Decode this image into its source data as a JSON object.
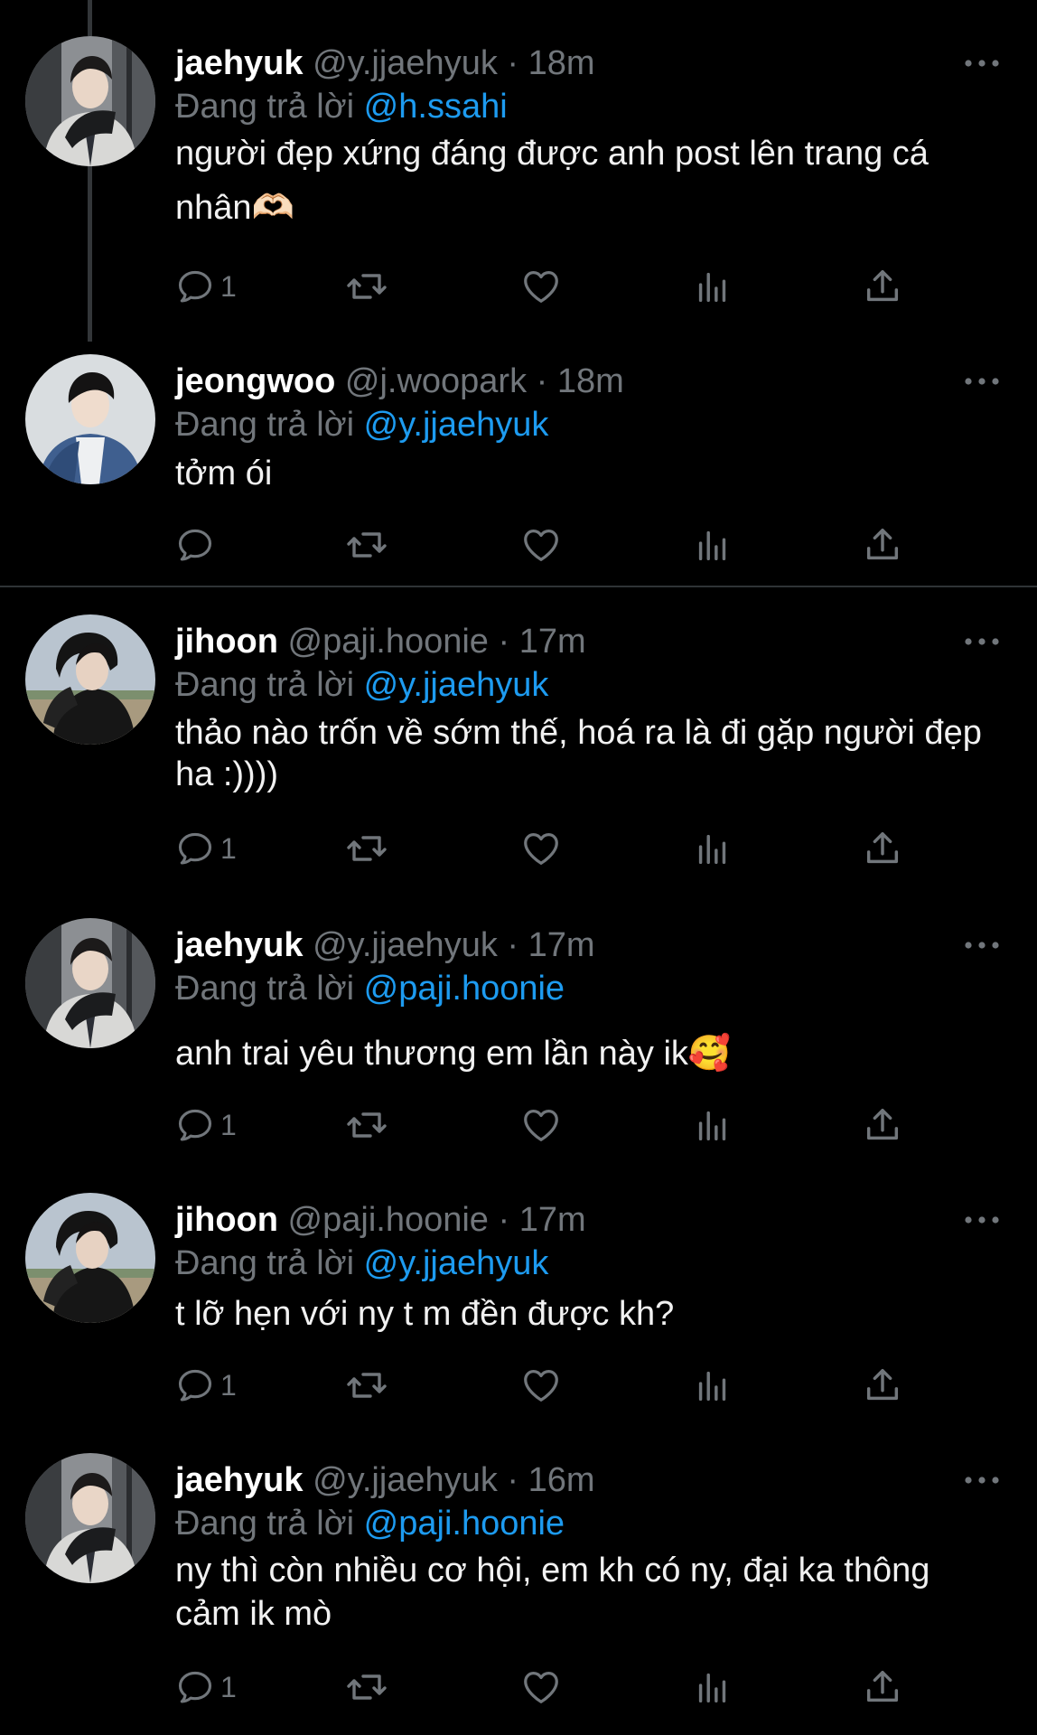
{
  "colors": {
    "background": "#000000",
    "text": "#e7e9ea",
    "muted": "#71767b",
    "mention": "#1d9bf0",
    "divider": "#2f3336"
  },
  "reply_prefix": "Đang trả lời",
  "tweets": [
    {
      "name": "jaehyuk",
      "meta": "@y.jjaehyuk · 18m",
      "reply_to": "@h.ssahi",
      "body": "người đẹp xứng đáng được anh post lên trang cá nhân🫶🏻",
      "reply_count": "1",
      "avatar": "jaehyuk-avatar"
    },
    {
      "name": "jeongwoo",
      "meta": "@j.woopark · 18m",
      "reply_to": "@y.jjaehyuk",
      "body": "tởm ói",
      "reply_count": "",
      "avatar": "jeongwoo-avatar"
    },
    {
      "name": "jihoon",
      "meta": "@paji.hoonie · 17m",
      "reply_to": "@y.jjaehyuk",
      "body": "thảo nào trốn về sớm thế, hoá ra là đi gặp người đẹp ha :))))",
      "reply_count": "1",
      "avatar": "jihoon-avatar"
    },
    {
      "name": "jaehyuk",
      "meta": "@y.jjaehyuk · 17m",
      "reply_to": "@paji.hoonie",
      "body": "anh trai yêu thương em lần này ik🥰",
      "reply_count": "1",
      "avatar": "jaehyuk-avatar"
    },
    {
      "name": "jihoon",
      "meta": "@paji.hoonie · 17m",
      "reply_to": "@y.jjaehyuk",
      "body": "t lỡ hẹn với ny t m đền được kh?",
      "reply_count": "1",
      "avatar": "jihoon-avatar"
    },
    {
      "name": "jaehyuk",
      "meta": "@y.jjaehyuk · 16m",
      "reply_to": "@paji.hoonie",
      "body": "ny thì còn nhiều cơ hội, em kh có ny, đại ka thông cảm ik mò",
      "reply_count": "1",
      "avatar": "jaehyuk-avatar"
    }
  ],
  "icons": {
    "reply": "reply-icon",
    "retweet": "retweet-icon",
    "like": "heart-icon",
    "views": "views-icon",
    "share": "share-icon",
    "more": "more-icon"
  }
}
